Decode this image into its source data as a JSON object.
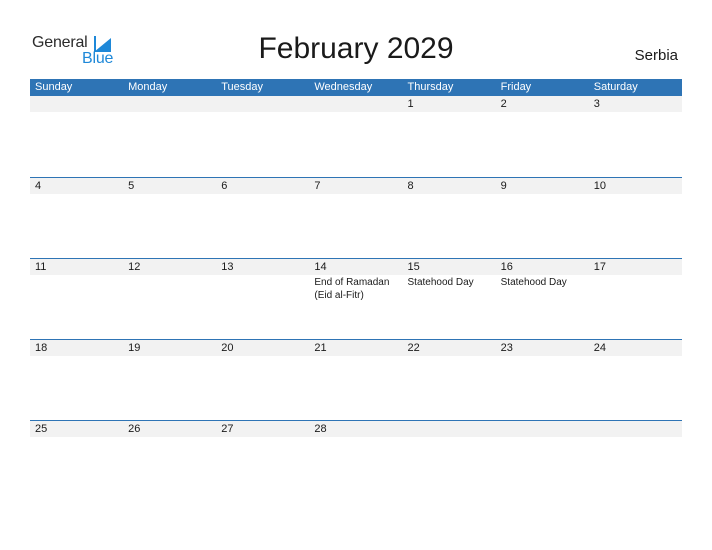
{
  "logo": {
    "line1": "General",
    "line2": "Blue"
  },
  "title": "February 2029",
  "country": "Serbia",
  "weekdays": [
    "Sunday",
    "Monday",
    "Tuesday",
    "Wednesday",
    "Thursday",
    "Friday",
    "Saturday"
  ],
  "weeks": [
    {
      "days": [
        "",
        "",
        "",
        "",
        "1",
        "2",
        "3"
      ],
      "events": [
        "",
        "",
        "",
        "",
        "",
        "",
        ""
      ]
    },
    {
      "days": [
        "4",
        "5",
        "6",
        "7",
        "8",
        "9",
        "10"
      ],
      "events": [
        "",
        "",
        "",
        "",
        "",
        "",
        ""
      ]
    },
    {
      "days": [
        "11",
        "12",
        "13",
        "14",
        "15",
        "16",
        "17"
      ],
      "events": [
        "",
        "",
        "",
        "End of Ramadan (Eid al-Fitr)",
        "Statehood Day",
        "Statehood Day",
        ""
      ]
    },
    {
      "days": [
        "18",
        "19",
        "20",
        "21",
        "22",
        "23",
        "24"
      ],
      "events": [
        "",
        "",
        "",
        "",
        "",
        "",
        ""
      ]
    },
    {
      "days": [
        "25",
        "26",
        "27",
        "28",
        "",
        "",
        ""
      ],
      "events": [
        "",
        "",
        "",
        "",
        "",
        "",
        ""
      ]
    }
  ],
  "colors": {
    "header": "#2e74b5",
    "date_strip": "#f2f2f2",
    "brand_blue": "#1e88d8"
  }
}
